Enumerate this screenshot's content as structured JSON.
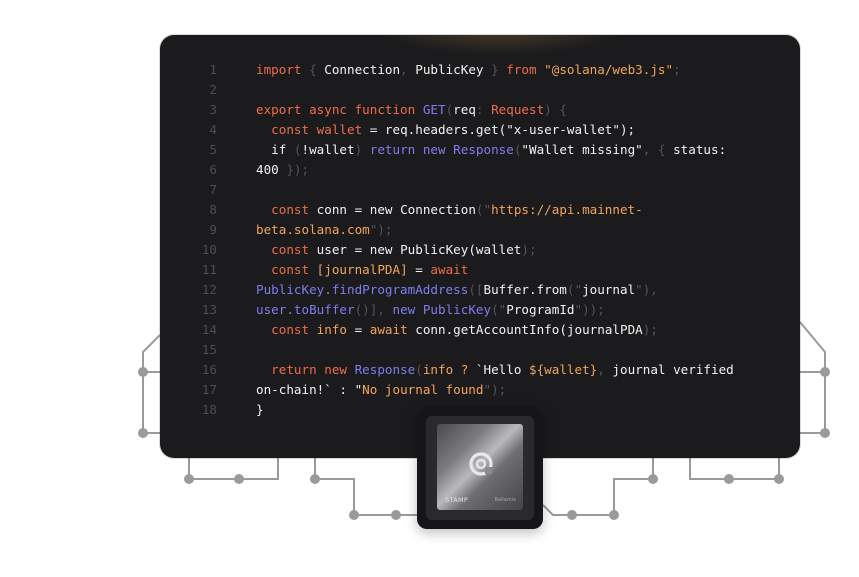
{
  "editor": {
    "lines": [
      {
        "n": "1",
        "t": [
          [
            "kw",
            "import "
          ],
          [
            "dim",
            "{ "
          ],
          [
            "tx",
            "Connection"
          ],
          [
            "dim",
            ", "
          ],
          [
            "tx",
            "PublicKey "
          ],
          [
            "dim",
            "} "
          ],
          [
            "kw",
            "from "
          ],
          [
            "str",
            "\"@solana/web3.js\""
          ],
          [
            "dim",
            ";"
          ]
        ]
      },
      {
        "n": "2",
        "t": []
      },
      {
        "n": "3",
        "t": [
          [
            "kw",
            "export async function "
          ],
          [
            "fn",
            "GET"
          ],
          [
            "dim",
            "("
          ],
          [
            "tx",
            "req"
          ],
          [
            "dim",
            ": "
          ],
          [
            "kw",
            "Request"
          ],
          [
            "dim",
            ") {"
          ]
        ]
      },
      {
        "n": "4",
        "t": [
          [
            "tx",
            "  "
          ],
          [
            "kw",
            "const "
          ],
          [
            "kw",
            "wallet "
          ],
          [
            "tx",
            "= req.headers.get(\"x-user-wallet\");"
          ]
        ]
      },
      {
        "n": "5",
        "t": [
          [
            "tx",
            "  if "
          ],
          [
            "dim",
            "("
          ],
          [
            "tx",
            "!wallet"
          ],
          [
            "dim",
            ") "
          ],
          [
            "fn",
            "return new Response"
          ],
          [
            "dim",
            "("
          ],
          [
            "tx",
            "\"Wallet missing\""
          ],
          [
            "dim",
            ", { "
          ],
          [
            "tx",
            "status:"
          ]
        ]
      },
      {
        "n": "6",
        "t": [
          [
            "tx",
            "400 "
          ],
          [
            "dim",
            "});"
          ]
        ]
      },
      {
        "n": "7",
        "t": []
      },
      {
        "n": "8",
        "t": [
          [
            "tx",
            "  "
          ],
          [
            "kw",
            "const "
          ],
          [
            "tx",
            "conn = new Connection"
          ],
          [
            "dim",
            "(\""
          ],
          [
            "str",
            "https://api.mainnet-"
          ]
        ]
      },
      {
        "n": "9",
        "t": [
          [
            "str",
            "beta.solana.com"
          ],
          [
            "dim",
            "\");"
          ]
        ]
      },
      {
        "n": "10",
        "t": [
          [
            "tx",
            "  "
          ],
          [
            "kw",
            "const "
          ],
          [
            "tx",
            "user = new PublicKey(wallet"
          ],
          [
            "dim",
            ");"
          ]
        ]
      },
      {
        "n": "11",
        "t": [
          [
            "tx",
            "  "
          ],
          [
            "kw",
            "const "
          ],
          [
            "str",
            "[journalPDA] "
          ],
          [
            "tx",
            "= "
          ],
          [
            "kw",
            "await"
          ]
        ]
      },
      {
        "n": "12",
        "t": [
          [
            "fn",
            "PublicKey.findProgramAddress"
          ],
          [
            "dim",
            "(["
          ],
          [
            "tx",
            "Buffer.from"
          ],
          [
            "dim",
            "(\""
          ],
          [
            "tx",
            "journal"
          ],
          [
            "dim",
            "\"),"
          ]
        ]
      },
      {
        "n": "13",
        "t": [
          [
            "fn",
            "user.toBuffer"
          ],
          [
            "dim",
            "()], "
          ],
          [
            "fn",
            "new PublicKey"
          ],
          [
            "dim",
            "(\""
          ],
          [
            "tx",
            "ProgramId"
          ],
          [
            "dim",
            "\"));"
          ]
        ]
      },
      {
        "n": "14",
        "t": [
          [
            "tx",
            "  "
          ],
          [
            "kw",
            "const "
          ],
          [
            "str",
            "info "
          ],
          [
            "tx",
            "= "
          ],
          [
            "str",
            "await "
          ],
          [
            "tx",
            "conn.getAccountInfo(journalPDA"
          ],
          [
            "dim",
            ");"
          ]
        ]
      },
      {
        "n": "15",
        "t": []
      },
      {
        "n": "16",
        "t": [
          [
            "tx",
            "  "
          ],
          [
            "kw",
            "return new "
          ],
          [
            "fn",
            "Response"
          ],
          [
            "dim",
            "("
          ],
          [
            "str",
            "info ? "
          ],
          [
            "tx",
            "`Hello "
          ],
          [
            "str",
            "${wallet}"
          ],
          [
            "dim",
            ", "
          ],
          [
            "tx",
            "journal verified"
          ]
        ]
      },
      {
        "n": "17",
        "t": [
          [
            "tx",
            "on-chain!` : \""
          ],
          [
            "str",
            "No journal found"
          ],
          [
            "dim",
            "\");"
          ]
        ]
      },
      {
        "n": "18",
        "t": [
          [
            "tx",
            "}"
          ]
        ]
      }
    ]
  },
  "chip": {
    "label_left": "STAMP",
    "label_right": "Ballamix"
  },
  "colors": {
    "keyword": "#ef6c4a",
    "function": "#7f7cf0",
    "string": "#f2a45a",
    "text": "#f2f2f2",
    "dim": "#55555a",
    "editor_bg": "#1b1b1d",
    "circuit": "#9a9a9a"
  }
}
